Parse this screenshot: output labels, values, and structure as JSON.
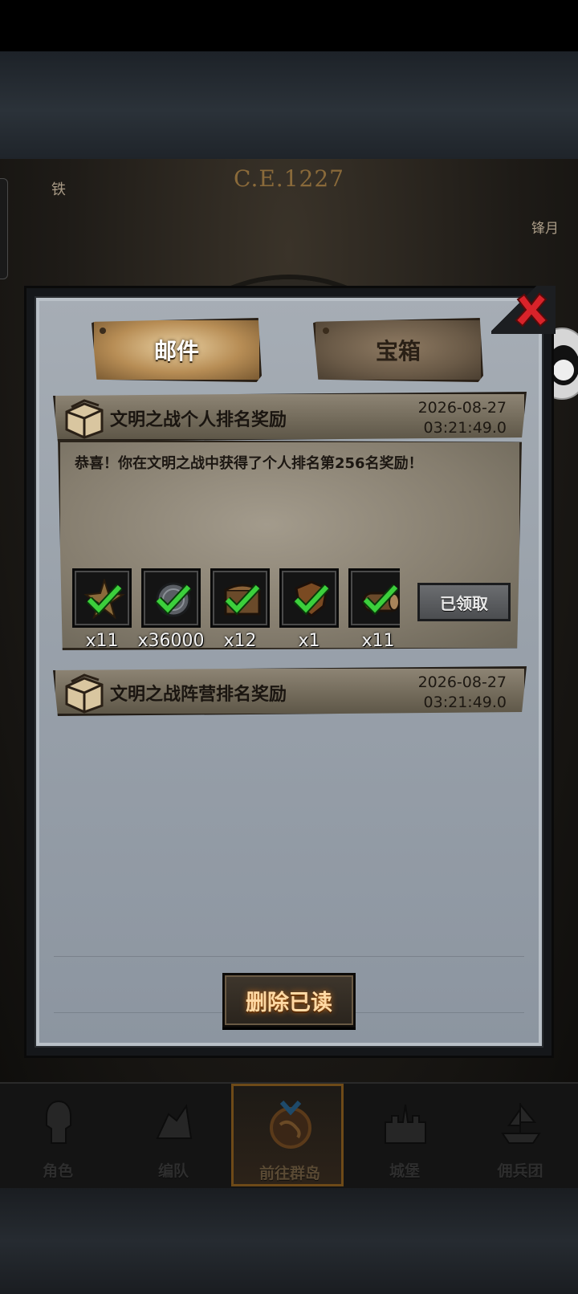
{
  "scene": {
    "era": "C.E.1227",
    "left_char": "铁",
    "right_label": "锋月"
  },
  "tabs": [
    {
      "label": "邮件",
      "active": true
    },
    {
      "label": "宝箱",
      "active": false
    }
  ],
  "mails": [
    {
      "title": "文明之战个人排名奖励",
      "date": "2026-08-27",
      "time": "03:21:49.0",
      "expanded": true,
      "body": "恭喜！你在文明之战中获得了个人排名第256名奖励！",
      "rewards": [
        {
          "icon": "star-emblem-icon",
          "count": "x11"
        },
        {
          "icon": "silver-coin-icon",
          "count": "x36000"
        },
        {
          "icon": "treasure-chest-icon",
          "count": "x12"
        },
        {
          "icon": "shield-icon",
          "count": "x1"
        },
        {
          "icon": "wood-log-icon",
          "count": "x11"
        }
      ],
      "claim_label": "已领取"
    },
    {
      "title": "文明之战阵营排名奖励",
      "date": "2026-08-27",
      "time": "03:21:49.0",
      "expanded": false
    }
  ],
  "delete_read_label": "删除已读",
  "nav": [
    {
      "label": "角色",
      "icon": "knight-icon"
    },
    {
      "label": "编队",
      "icon": "formation-icon"
    },
    {
      "label": "前往群岛",
      "icon": "globe-icon",
      "active": true
    },
    {
      "label": "城堡",
      "icon": "castle-icon"
    },
    {
      "label": "佣兵团",
      "icon": "mercenary-ship-icon"
    }
  ],
  "colors": {
    "accent_gold": "#b78d55",
    "check_green": "#3ccf3c",
    "close_red": "#d8232a",
    "delete_text": "#ffd9a4"
  }
}
